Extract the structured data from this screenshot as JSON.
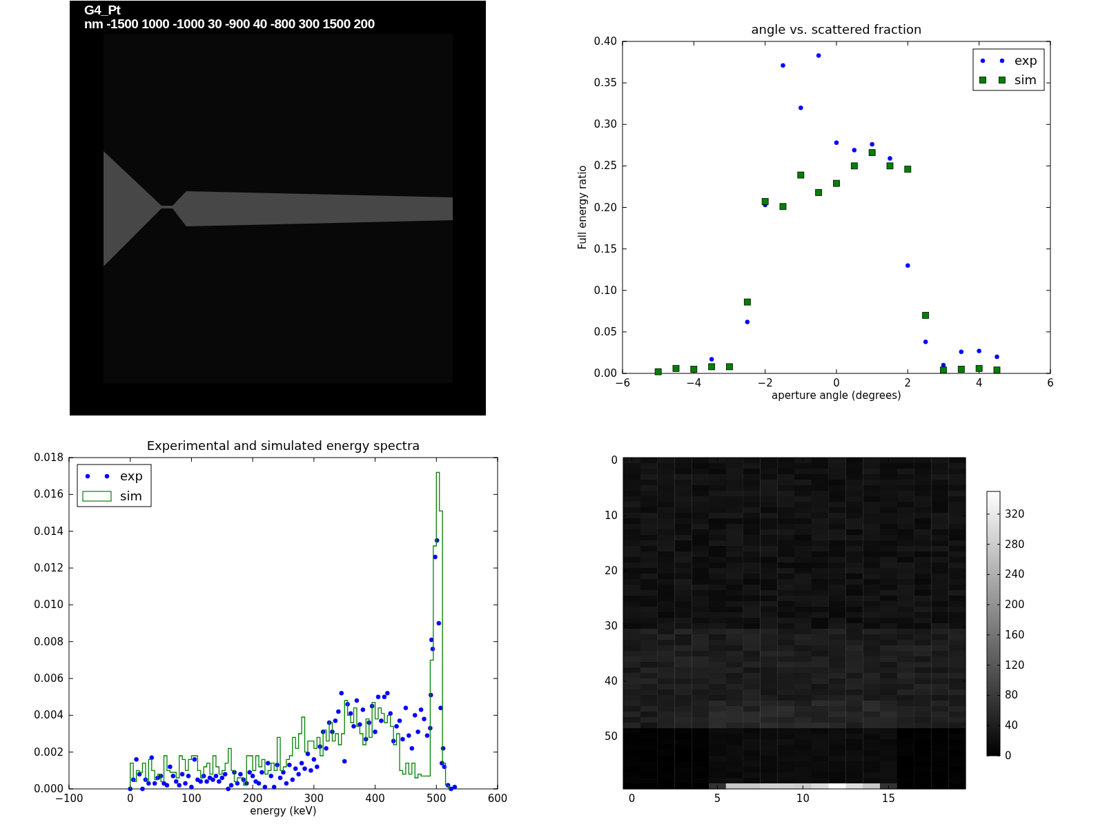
{
  "geometry_view": {
    "title": "G4_Pt",
    "caption": "nm -1500 1000 -1000 30 -900 40 -800 300 1500 200"
  },
  "scatter_plot": {
    "chart_data": {
      "type": "scatter",
      "title": "angle vs. scattered fraction",
      "xlabel": "aperture angle (degrees)",
      "ylabel": "Full energy ratio",
      "x": [
        -5,
        -4.5,
        -4,
        -3.5,
        -3,
        -2.5,
        -2,
        -1.5,
        -1,
        -0.5,
        0,
        0.5,
        1,
        1.5,
        2,
        2.5,
        3,
        3.5,
        4,
        4.5
      ],
      "series": [
        {
          "name": "exp",
          "color": "#0000ff",
          "values": [
            null,
            null,
            null,
            0.017,
            null,
            0.062,
            0.203,
            0.371,
            0.32,
            0.383,
            0.278,
            0.269,
            0.276,
            0.259,
            0.13,
            0.038,
            0.01,
            0.026,
            0.027,
            0.02
          ]
        },
        {
          "name": "sim",
          "color": "#008000",
          "values": [
            0.002,
            0.006,
            0.005,
            0.008,
            0.008,
            0.086,
            0.207,
            0.201,
            0.239,
            0.218,
            0.229,
            0.25,
            0.266,
            0.25,
            0.246,
            0.07,
            0.004,
            0.005,
            0.006,
            0.004
          ]
        }
      ],
      "xlim": [
        -6,
        6
      ],
      "ylim": [
        0,
        0.4
      ],
      "legend": "upper right",
      "xticks": [
        {
          "value": -6,
          "label": "−6"
        },
        {
          "value": -4,
          "label": "−4"
        },
        {
          "value": -2,
          "label": "−2"
        },
        {
          "value": 0,
          "label": "0"
        },
        {
          "value": 2,
          "label": "2"
        },
        {
          "value": 4,
          "label": "4"
        },
        {
          "value": 6,
          "label": "6"
        }
      ],
      "yticks": [
        {
          "value": 0,
          "label": "0.00"
        },
        {
          "value": 0.05,
          "label": "0.05"
        },
        {
          "value": 0.1,
          "label": "0.10"
        },
        {
          "value": 0.15,
          "label": "0.15"
        },
        {
          "value": 0.2,
          "label": "0.20"
        },
        {
          "value": 0.25,
          "label": "0.25"
        },
        {
          "value": 0.3,
          "label": "0.30"
        },
        {
          "value": 0.35,
          "label": "0.35"
        },
        {
          "value": 0.4,
          "label": "0.40"
        }
      ]
    }
  },
  "spectrum_plot": {
    "chart_data": {
      "type": "line",
      "title": "Experimental and simulated energy spectra",
      "xlabel": "energy (keV)",
      "series": [
        {
          "name": "exp",
          "type": "scatter",
          "color": "#0000ff",
          "x": [
            0,
            5,
            10,
            15,
            20,
            25,
            30,
            35,
            40,
            45,
            50,
            55,
            60,
            65,
            70,
            75,
            80,
            85,
            90,
            95,
            100,
            105,
            110,
            115,
            120,
            125,
            130,
            135,
            140,
            145,
            150,
            155,
            160,
            165,
            170,
            175,
            180,
            185,
            190,
            195,
            200,
            205,
            210,
            215,
            220,
            225,
            230,
            235,
            240,
            245,
            250,
            255,
            260,
            265,
            270,
            275,
            280,
            285,
            290,
            295,
            300,
            305,
            310,
            315,
            320,
            325,
            330,
            335,
            340,
            345,
            350,
            355,
            360,
            365,
            370,
            375,
            380,
            385,
            390,
            395,
            400,
            405,
            410,
            415,
            420,
            425,
            430,
            435,
            440,
            445,
            450,
            455,
            460,
            465,
            470,
            475,
            480,
            485,
            490,
            491,
            492,
            494,
            498,
            501,
            504,
            507,
            509,
            511,
            513,
            519,
            524,
            530
          ],
          "values": [
            0.0,
            0.0005,
            0.0016,
            0.0008,
            0.0,
            0.0005,
            0.0003,
            0.0017,
            0.0003,
            0.0006,
            0.0007,
            0.0003,
            0.0002,
            0.0012,
            0.0007,
            0.0004,
            0.0002,
            0.0008,
            0.0003,
            0.0007,
            0.0001,
            0.0016,
            0.0005,
            0.0004,
            0.0007,
            0.0004,
            0.0006,
            0.0005,
            0.0007,
            0.0004,
            0.0006,
            0.0008,
            0.0,
            0.0002,
            0.0009,
            0.0003,
            0.0008,
            0.0005,
            0.0003,
            0.0009,
            0.0007,
            0.0004,
            0.0003,
            0.0009,
            0.0001,
            0.0014,
            0.0007,
            0.0001,
            0.0013,
            0.0006,
            0.0009,
            0.0003,
            0.0013,
            0.0005,
            0.0011,
            0.0008,
            0.0014,
            0.0011,
            0.0019,
            0.001,
            0.0016,
            0.0012,
            0.0023,
            0.0031,
            0.0022,
            0.0036,
            0.0031,
            0.0037,
            0.0042,
            0.0052,
            0.0015,
            0.0046,
            0.0041,
            0.0034,
            0.0048,
            0.0035,
            0.0043,
            0.0027,
            0.0036,
            0.0045,
            0.0031,
            0.005,
            0.0037,
            0.005,
            0.0052,
            0.0041,
            0.0026,
            0.0034,
            0.0037,
            0.0027,
            0.0044,
            0.0029,
            0.0022,
            0.004,
            0.0031,
            0.0043,
            0.0038,
            0.0029,
            0.0033,
            0.0051,
            0.0081,
            0.0076,
            0.0126,
            0.0135,
            0.009,
            0.0044,
            0.0014,
            0.0022,
            0.0012,
            0.0002,
            0.0,
            0.0001
          ]
        },
        {
          "name": "sim",
          "type": "line",
          "color": "#008000",
          "x": [
            0,
            0,
            5,
            5,
            10,
            10,
            15,
            15,
            20,
            20,
            25,
            25,
            30,
            30,
            35,
            35,
            40,
            40,
            45,
            45,
            50,
            50,
            55,
            55,
            60,
            60,
            65,
            65,
            70,
            70,
            75,
            75,
            80,
            80,
            85,
            85,
            90,
            90,
            95,
            95,
            100,
            100,
            105,
            105,
            110,
            110,
            115,
            115,
            120,
            120,
            125,
            125,
            130,
            130,
            135,
            135,
            140,
            140,
            145,
            145,
            150,
            150,
            155,
            155,
            160,
            160,
            165,
            165,
            170,
            170,
            175,
            175,
            180,
            180,
            185,
            185,
            190,
            190,
            195,
            195,
            200,
            200,
            205,
            205,
            210,
            210,
            215,
            215,
            220,
            220,
            225,
            225,
            230,
            230,
            235,
            235,
            240,
            240,
            245,
            245,
            250,
            250,
            255,
            255,
            260,
            260,
            265,
            265,
            270,
            270,
            275,
            275,
            280,
            280,
            285,
            285,
            290,
            290,
            295,
            295,
            300,
            300,
            305,
            305,
            310,
            310,
            315,
            315,
            320,
            320,
            325,
            325,
            330,
            330,
            335,
            335,
            340,
            340,
            345,
            345,
            350,
            350,
            355,
            355,
            360,
            360,
            365,
            365,
            370,
            370,
            375,
            375,
            380,
            380,
            385,
            385,
            390,
            390,
            395,
            395,
            400,
            400,
            405,
            405,
            410,
            410,
            415,
            415,
            420,
            420,
            425,
            425,
            430,
            430,
            435,
            435,
            440,
            440,
            445,
            445,
            450,
            450,
            455,
            455,
            460,
            460,
            465,
            465,
            470,
            470,
            475,
            475,
            480,
            480,
            485,
            485,
            490,
            490,
            495,
            495,
            500,
            500,
            505,
            505,
            510,
            510,
            515,
            515,
            520,
            520
          ],
          "values": [
            0,
            0.0014,
            0.0014,
            0.0004,
            0.0004,
            0.001,
            0.001,
            0.0009,
            0.0009,
            0.0014,
            0.0014,
            0.0004,
            0.0004,
            0.0016,
            0.0016,
            0.001,
            0.001,
            0.0005,
            0.0005,
            0.0008,
            0.0008,
            0.0004,
            0.0004,
            0.0018,
            0.0018,
            0.001,
            0.001,
            0.0009,
            0.0009,
            0.0009,
            0.0009,
            0.0006,
            0.0006,
            0.0018,
            0.0018,
            0.0016,
            0.0016,
            0.001,
            0.001,
            0.0016,
            0.0016,
            0.0018,
            0.0018,
            0.0018,
            0.0018,
            0.001,
            0.001,
            0.0006,
            0.0006,
            0.0012,
            0.0012,
            0.0014,
            0.0014,
            0.0008,
            0.0008,
            0.0018,
            0.0018,
            0.0012,
            0.0012,
            0.0008,
            0.0008,
            0.001,
            0.001,
            0.0014,
            0.0014,
            0.0022,
            0.0022,
            0.001,
            0.001,
            0.0004,
            0.0004,
            0.0006,
            0.0006,
            0.0006,
            0.0006,
            0.0002,
            0.0002,
            0.0018,
            0.0018,
            0.0018,
            0.0018,
            0.001,
            0.001,
            0.0018,
            0.0018,
            0.0012,
            0.0012,
            0.0016,
            0.0016,
            0.0008,
            0.0008,
            0.001,
            0.001,
            0.0014,
            0.0014,
            0.001,
            0.001,
            0.0028,
            0.0028,
            0.001,
            0.001,
            0.0012,
            0.0012,
            0.0016,
            0.0016,
            0.0018,
            0.0018,
            0.0028,
            0.0028,
            0.0022,
            0.0022,
            0.003,
            0.003,
            0.0039,
            0.0039,
            0.002,
            0.002,
            0.0026,
            0.0026,
            0.0026,
            0.0026,
            0.0022,
            0.0022,
            0.0028,
            0.0028,
            0.0018,
            0.0018,
            0.0032,
            0.0032,
            0.0026,
            0.0026,
            0.0036,
            0.0036,
            0.0026,
            0.0026,
            0.003,
            0.003,
            0.0024,
            0.0024,
            0.003,
            0.003,
            0.0048,
            0.0048,
            0.004,
            0.004,
            0.0036,
            0.0036,
            0.0044,
            0.0044,
            0.0034,
            0.0034,
            0.003,
            0.003,
            0.0024,
            0.0024,
            0.0038,
            0.0038,
            0.0028,
            0.0028,
            0.0047,
            0.0047,
            0.0038,
            0.0038,
            0.0044,
            0.0044,
            0.0041,
            0.0041,
            0.0036,
            0.0036,
            0.004,
            0.004,
            0.0034,
            0.0034,
            0.0024,
            0.0024,
            0.003,
            0.003,
            0.001,
            0.001,
            0.0008,
            0.0008,
            0.0014,
            0.0014,
            0.0008,
            0.0008,
            0.0014,
            0.0014,
            0.0006,
            0.0006,
            0.0008,
            0.0008,
            0.0007,
            0.0007,
            0.0007,
            0.0007,
            0.0007,
            0.0007,
            0.007,
            0.007,
            0.0132,
            0.0132,
            0.0172,
            0.0172,
            0.0151,
            0.0151,
            0.0014,
            0.0014,
            0.0002,
            0.0002,
            0
          ]
        }
      ],
      "xlim": [
        -100,
        600
      ],
      "ylim": [
        0,
        0.018
      ],
      "legend": "upper left",
      "xticks": [
        {
          "value": -100,
          "label": "−100"
        },
        {
          "value": 0,
          "label": "0"
        },
        {
          "value": 100,
          "label": "100"
        },
        {
          "value": 200,
          "label": "200"
        },
        {
          "value": 300,
          "label": "300"
        },
        {
          "value": 400,
          "label": "400"
        },
        {
          "value": 500,
          "label": "500"
        },
        {
          "value": 600,
          "label": "600"
        }
      ],
      "yticks": [
        {
          "value": 0,
          "label": "0.000"
        },
        {
          "value": 0.002,
          "label": "0.002"
        },
        {
          "value": 0.004,
          "label": "0.004"
        },
        {
          "value": 0.006,
          "label": "0.006"
        },
        {
          "value": 0.008,
          "label": "0.008"
        },
        {
          "value": 0.01,
          "label": "0.010"
        },
        {
          "value": 0.012,
          "label": "0.012"
        },
        {
          "value": 0.014,
          "label": "0.014"
        },
        {
          "value": 0.016,
          "label": "0.016"
        },
        {
          "value": 0.018,
          "label": "0.018"
        }
      ]
    }
  },
  "heatmap": {
    "x_ticks": [
      "0",
      "5",
      "10",
      "15"
    ],
    "y_ticks": [
      "0",
      "10",
      "20",
      "30",
      "40",
      "50"
    ],
    "colorbar_ticks": [
      "320",
      "280",
      "240",
      "200",
      "160",
      "120",
      "80",
      "40",
      "0"
    ]
  }
}
